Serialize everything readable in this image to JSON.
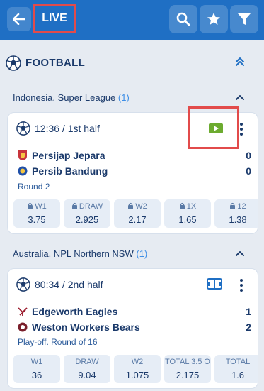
{
  "header": {
    "title": "LIVE"
  },
  "sport": {
    "title": "FOOTBALL"
  },
  "leagues": [
    {
      "name": "Indonesia. Super League",
      "count": "(1)",
      "match": {
        "time": "12:36 / 1st half",
        "team1": "Persijap Jepara",
        "team2": "Persib Bandung",
        "score1": "0",
        "score2": "0",
        "round": "Round 2",
        "odds": [
          {
            "label": "W1",
            "value": "3.75",
            "locked": true
          },
          {
            "label": "DRAW",
            "value": "2.925",
            "locked": true
          },
          {
            "label": "W2",
            "value": "2.17",
            "locked": true
          },
          {
            "label": "1X",
            "value": "1.65",
            "locked": true
          },
          {
            "label": "12",
            "value": "1.38",
            "locked": true
          }
        ]
      }
    },
    {
      "name": "Australia. NPL Northern NSW",
      "count": "(1)",
      "match": {
        "time": "80:34 / 2nd half",
        "team1": "Edgeworth Eagles",
        "team2": "Weston Workers Bears",
        "score1": "1",
        "score2": "2",
        "round": "Play-off. Round of 16",
        "odds": [
          {
            "label": "W1",
            "value": "36",
            "locked": false
          },
          {
            "label": "DRAW",
            "value": "9.04",
            "locked": false
          },
          {
            "label": "W2",
            "value": "1.075",
            "locked": false
          },
          {
            "label": "TOTAL 3.5 O",
            "value": "2.175",
            "locked": false
          },
          {
            "label": "TOTAL",
            "value": "1.6",
            "locked": false
          }
        ]
      }
    }
  ],
  "icons": {
    "back": "arrow-left-icon",
    "search": "search-icon",
    "favorite": "star-icon",
    "filter": "filter-icon",
    "video": "video-play-icon",
    "field": "field-scheme-icon"
  },
  "colors": {
    "header_bg": "#1f6fc4",
    "accent": "#3d8ee6",
    "highlight_box": "#e24b4b",
    "video_green": "#6cab2f"
  }
}
